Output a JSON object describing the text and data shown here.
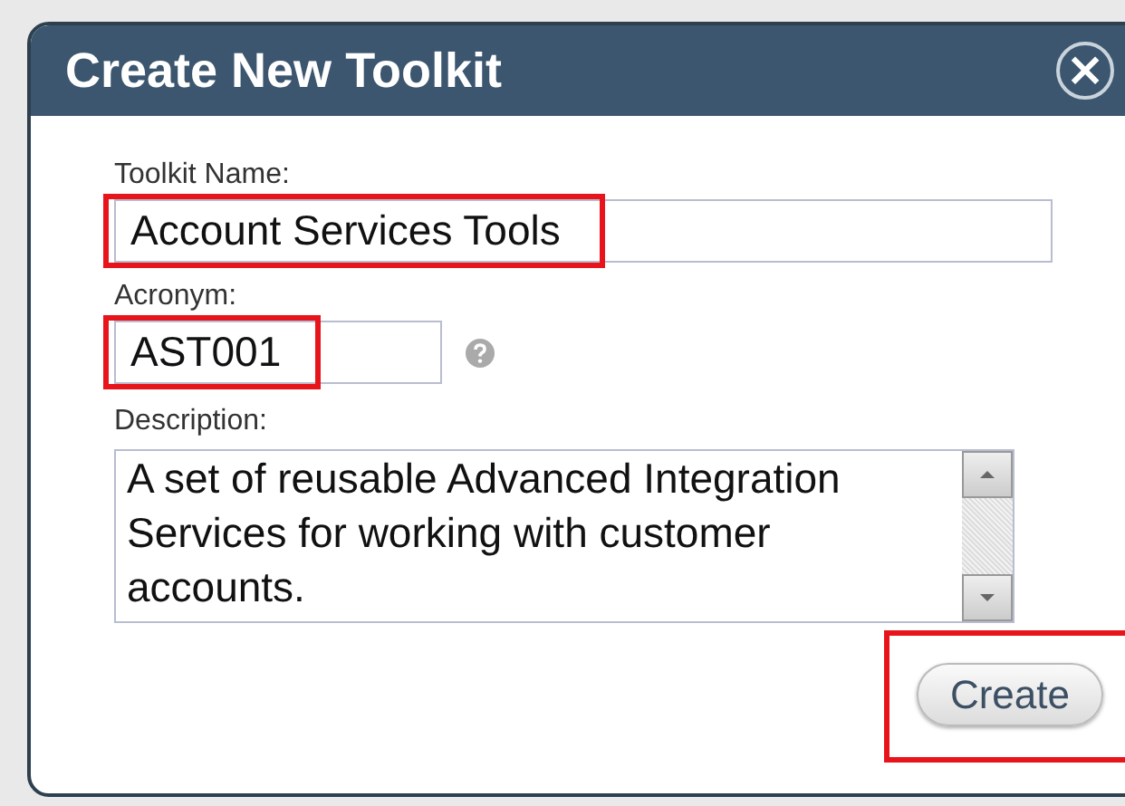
{
  "dialog": {
    "title": "Create New Toolkit",
    "close_icon": "×"
  },
  "name_field": {
    "label": "Toolkit Name:",
    "value": "Account Services Tools",
    "highlighted": true
  },
  "acronym_field": {
    "label": "Acronym:",
    "value": "AST001",
    "highlighted": true
  },
  "description_field": {
    "label": "Description:",
    "value": "A set of reusable Advanced Integration Services for working with customer accounts."
  },
  "create_button": {
    "label": "Create",
    "highlighted": true
  }
}
